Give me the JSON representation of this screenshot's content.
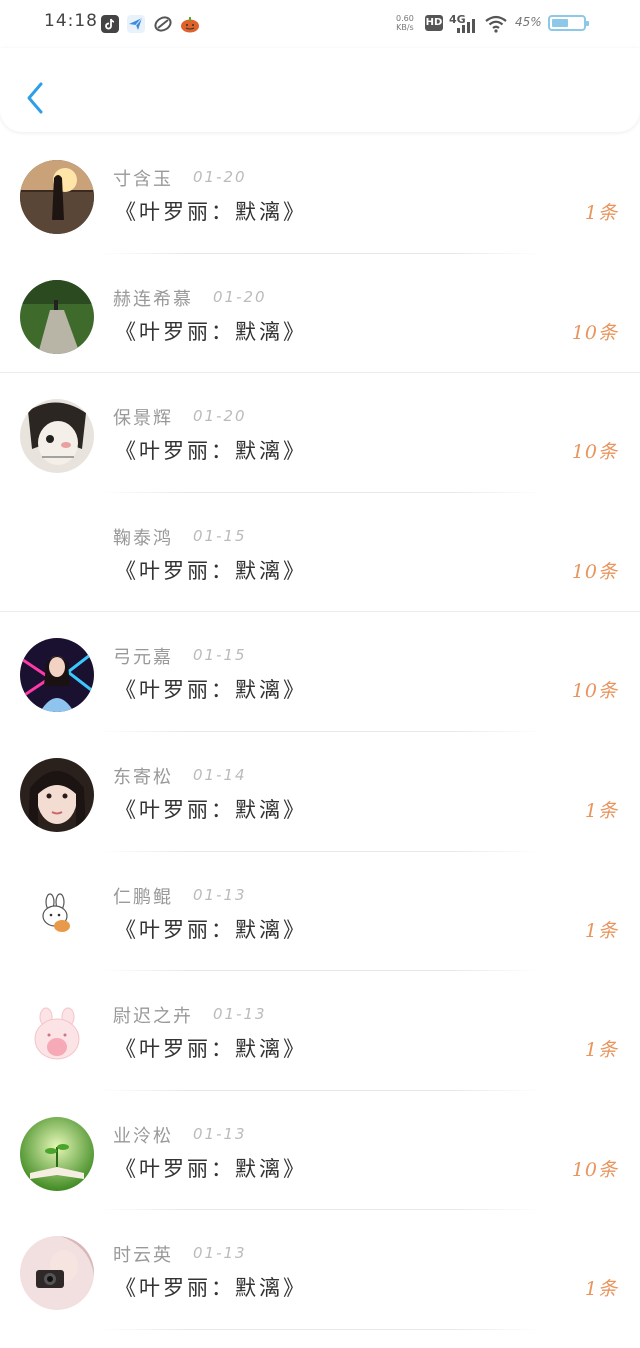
{
  "status_bar": {
    "time": "14:18",
    "net_speed_value": "0.60",
    "net_speed_unit": "KB/s",
    "hd": "HD",
    "network": "4G",
    "battery": "45%",
    "battery_level": 0.45,
    "app_icons": [
      "douyin-icon",
      "feishu-icon",
      "link-app-icon",
      "pumpkin-app-icon"
    ]
  },
  "header": {
    "back_icon": "chevron-left-icon"
  },
  "colors": {
    "accent_blue": "#2f9ee8",
    "count_orange": "#e8955e"
  },
  "messages": [
    {
      "name": "寸含玉",
      "date": "01-20",
      "title": "《叶罗丽：默漓》",
      "count": "1条",
      "avatar": "sunset-girl-avatar"
    },
    {
      "name": "赫连希慕",
      "date": "01-20",
      "title": "《叶罗丽：默漓》",
      "count": "10条",
      "avatar": "garden-path-avatar"
    },
    {
      "name": "保景辉",
      "date": "01-20",
      "title": "《叶罗丽：默漓》",
      "count": "10条",
      "avatar": "sketch-girl-avatar"
    },
    {
      "name": "鞠泰鸿",
      "date": "01-15",
      "title": "《叶罗丽：默漓》",
      "count": "10条",
      "avatar": ""
    },
    {
      "name": "弓元嘉",
      "date": "01-15",
      "title": "《叶罗丽：默漓》",
      "count": "10条",
      "avatar": "neon-girl-avatar"
    },
    {
      "name": "东寄松",
      "date": "01-14",
      "title": "《叶罗丽：默漓》",
      "count": "1条",
      "avatar": "portrait-girl-avatar"
    },
    {
      "name": "仁鹏鲲",
      "date": "01-13",
      "title": "《叶罗丽：默漓》",
      "count": "1条",
      "avatar": "bunny-sticker-avatar"
    },
    {
      "name": "尉迟之卉",
      "date": "01-13",
      "title": "《叶罗丽：默漓》",
      "count": "1条",
      "avatar": "pink-bunny-avatar"
    },
    {
      "name": "业泠松",
      "date": "01-13",
      "title": "《叶罗丽：默漓》",
      "count": "10条",
      "avatar": "book-sprout-avatar"
    },
    {
      "name": "时云英",
      "date": "01-13",
      "title": "《叶罗丽：默漓》",
      "count": "1条",
      "avatar": "camera-girl-avatar"
    }
  ]
}
